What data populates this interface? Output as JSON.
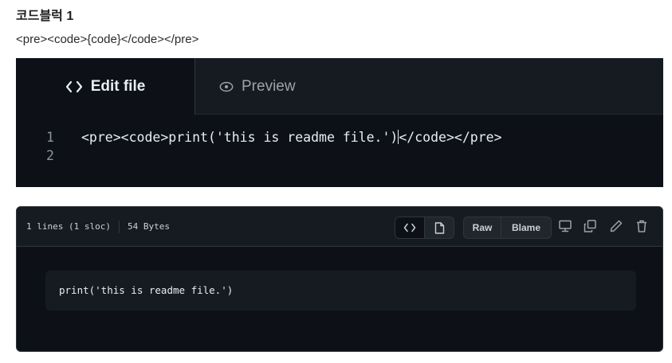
{
  "heading": "코드블럭 1",
  "caption": "<pre><code>{code}</code></pre>",
  "editor": {
    "tabs": [
      {
        "label": "Edit file",
        "icon": "code-icon",
        "active": true
      },
      {
        "label": "Preview",
        "icon": "eye-icon",
        "active": false
      }
    ],
    "lines": [
      {
        "number": "1",
        "before_cursor": "<pre><code>print('this is readme file.')",
        "after_cursor": "</code></pre>"
      },
      {
        "number": "2",
        "before_cursor": "",
        "after_cursor": ""
      }
    ]
  },
  "viewer": {
    "meta": {
      "lines": "1 lines (1 sloc)",
      "size": "54 Bytes"
    },
    "buttons": {
      "code_view": "code-icon",
      "file_view": "file-icon",
      "raw": "Raw",
      "blame": "Blame"
    },
    "tools": [
      "desktop-icon",
      "copy-icon",
      "pencil-icon",
      "trash-icon"
    ],
    "code": "print('this is readme file.')"
  },
  "colors": {
    "editor_bg": "#0d1117",
    "header_bg": "#161b22",
    "border": "#30363d",
    "text": "#e6edf3",
    "muted": "#8b949e"
  }
}
